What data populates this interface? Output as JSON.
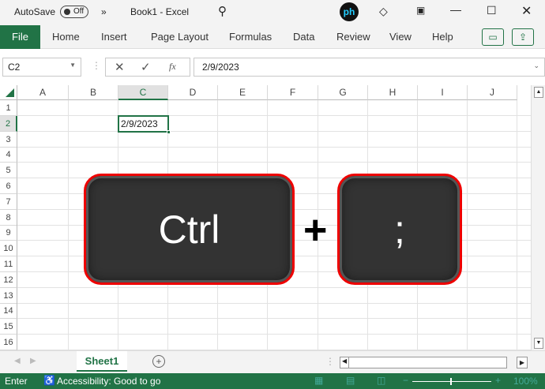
{
  "title": {
    "autosave_label": "AutoSave",
    "autosave_state": "Off",
    "more": "»",
    "doc_title": "Book1 - Excel"
  },
  "ribbon": {
    "tabs": [
      "File",
      "Home",
      "Insert",
      "Page Layout",
      "Formulas",
      "Data",
      "Review",
      "View",
      "Help"
    ]
  },
  "formula_bar": {
    "name_box": "C2",
    "fx": "fx",
    "value": "2/9/2023"
  },
  "columns": [
    "A",
    "B",
    "C",
    "D",
    "E",
    "F",
    "G",
    "H",
    "I",
    "J"
  ],
  "rows": [
    "1",
    "2",
    "3",
    "4",
    "5",
    "6",
    "7",
    "8",
    "9",
    "10",
    "11",
    "12",
    "13",
    "14",
    "15",
    "16"
  ],
  "cell_c2": "2/9/2023",
  "overlay": {
    "key1": "Ctrl",
    "plus": "+",
    "key2": ";"
  },
  "sheets": {
    "tabs": [
      "Sheet1"
    ],
    "add": "+"
  },
  "status": {
    "mode": "Enter",
    "accessibility": "Accessibility: Good to go",
    "zoom": "100%"
  },
  "colors": {
    "excel_green": "#217346",
    "key_border": "#e00000"
  }
}
